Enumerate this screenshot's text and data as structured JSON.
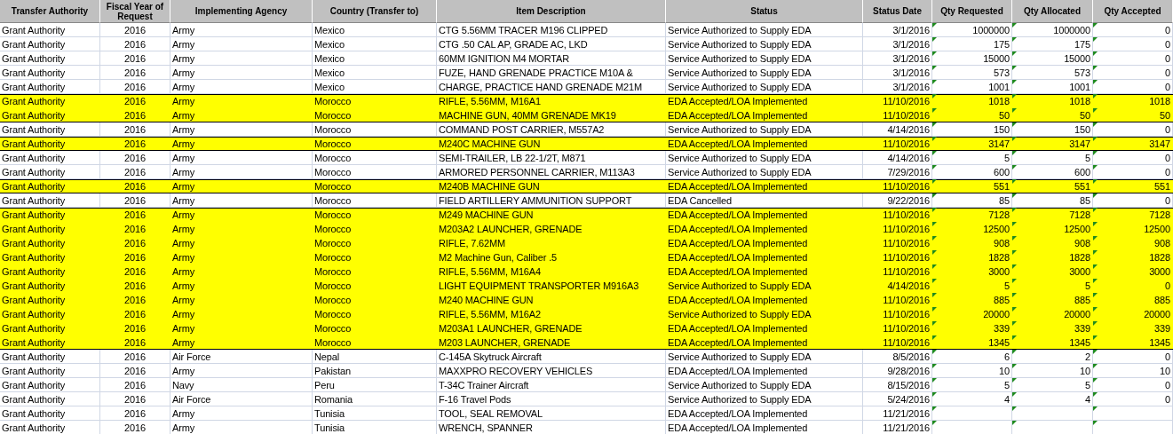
{
  "table": {
    "columns": [
      "Transfer Authority",
      "Fiscal Year of Request",
      "Implementing Agency",
      "Country (Transfer to)",
      "Item Description",
      "Status",
      "Status Date",
      "Qty Requested",
      "Qty Allocated",
      "Qty Accepted"
    ],
    "rows": [
      {
        "highlighted": false,
        "cells": [
          "Grant Authority",
          "2016",
          "Army",
          "Mexico",
          "CTG 5.56MM TRACER M196 CLIPPED",
          "Service Authorized to Supply EDA",
          "3/1/2016",
          "1000000",
          "1000000",
          "0"
        ]
      },
      {
        "highlighted": false,
        "cells": [
          "Grant Authority",
          "2016",
          "Army",
          "Mexico",
          "CTG .50 CAL AP, GRADE AC, LKD",
          "Service Authorized to Supply EDA",
          "3/1/2016",
          "175",
          "175",
          "0"
        ]
      },
      {
        "highlighted": false,
        "cells": [
          "Grant Authority",
          "2016",
          "Army",
          "Mexico",
          "60MM IGNITION M4 MORTAR",
          "Service Authorized to Supply EDA",
          "3/1/2016",
          "15000",
          "15000",
          "0"
        ]
      },
      {
        "highlighted": false,
        "cells": [
          "Grant Authority",
          "2016",
          "Army",
          "Mexico",
          "FUZE, HAND GRENADE PRACTICE M10A &",
          "Service Authorized to Supply EDA",
          "3/1/2016",
          "573",
          "573",
          "0"
        ]
      },
      {
        "highlighted": false,
        "cells": [
          "Grant Authority",
          "2016",
          "Army",
          "Mexico",
          "CHARGE, PRACTICE HAND GRENADE M21M",
          "Service Authorized to Supply EDA",
          "3/1/2016",
          "1001",
          "1001",
          "0"
        ]
      },
      {
        "highlighted": true,
        "cells": [
          "Grant Authority",
          "2016",
          "Army",
          "Morocco",
          "RIFLE, 5.56MM, M16A1",
          "EDA Accepted/LOA Implemented",
          "11/10/2016",
          "1018",
          "1018",
          "1018"
        ]
      },
      {
        "highlighted": true,
        "cells": [
          "Grant Authority",
          "2016",
          "Army",
          "Morocco",
          "MACHINE GUN, 40MM GRENADE MK19",
          "EDA Accepted/LOA Implemented",
          "11/10/2016",
          "50",
          "50",
          "50"
        ]
      },
      {
        "highlighted": false,
        "cells": [
          "Grant Authority",
          "2016",
          "Army",
          "Morocco",
          "COMMAND POST CARRIER, M557A2",
          "Service Authorized to Supply EDA",
          "4/14/2016",
          "150",
          "150",
          "0"
        ]
      },
      {
        "highlighted": true,
        "cells": [
          "Grant Authority",
          "2016",
          "Army",
          "Morocco",
          "M240C MACHINE GUN",
          "EDA Accepted/LOA Implemented",
          "11/10/2016",
          "3147",
          "3147",
          "3147"
        ]
      },
      {
        "highlighted": false,
        "cells": [
          "Grant Authority",
          "2016",
          "Army",
          "Morocco",
          "SEMI-TRAILER, LB 22-1/2T, M871",
          "Service Authorized to Supply EDA",
          "4/14/2016",
          "5",
          "5",
          "0"
        ]
      },
      {
        "highlighted": false,
        "cells": [
          "Grant Authority",
          "2016",
          "Army",
          "Morocco",
          "ARMORED PERSONNEL CARRIER, M113A3",
          "Service Authorized to Supply EDA",
          "7/29/2016",
          "600",
          "600",
          "0"
        ]
      },
      {
        "highlighted": true,
        "cells": [
          "Grant Authority",
          "2016",
          "Army",
          "Morocco",
          "M240B MACHINE GUN",
          "EDA Accepted/LOA Implemented",
          "11/10/2016",
          "551",
          "551",
          "551"
        ]
      },
      {
        "highlighted": false,
        "cells": [
          "Grant Authority",
          "2016",
          "Army",
          "Morocco",
          "FIELD ARTILLERY AMMUNITION SUPPORT",
          "EDA Cancelled",
          "9/22/2016",
          "85",
          "85",
          "0"
        ]
      },
      {
        "highlighted": true,
        "cells": [
          "Grant Authority",
          "2016",
          "Army",
          "Morocco",
          "M249 MACHINE GUN",
          "EDA Accepted/LOA Implemented",
          "11/10/2016",
          "7128",
          "7128",
          "7128"
        ]
      },
      {
        "highlighted": true,
        "cells": [
          "Grant Authority",
          "2016",
          "Army",
          "Morocco",
          "M203A2 LAUNCHER, GRENADE",
          "EDA Accepted/LOA Implemented",
          "11/10/2016",
          "12500",
          "12500",
          "12500"
        ]
      },
      {
        "highlighted": true,
        "cells": [
          "Grant Authority",
          "2016",
          "Army",
          "Morocco",
          "RIFLE, 7.62MM",
          "EDA Accepted/LOA Implemented",
          "11/10/2016",
          "908",
          "908",
          "908"
        ]
      },
      {
        "highlighted": true,
        "cells": [
          "Grant Authority",
          "2016",
          "Army",
          "Morocco",
          "M2 Machine Gun, Caliber .5",
          "EDA Accepted/LOA Implemented",
          "11/10/2016",
          "1828",
          "1828",
          "1828"
        ]
      },
      {
        "highlighted": true,
        "cells": [
          "Grant Authority",
          "2016",
          "Army",
          "Morocco",
          "RIFLE, 5.56MM, M16A4",
          "EDA Accepted/LOA Implemented",
          "11/10/2016",
          "3000",
          "3000",
          "3000"
        ]
      },
      {
        "highlighted": true,
        "cells": [
          "Grant Authority",
          "2016",
          "Army",
          "Morocco",
          "LIGHT EQUIPMENT TRANSPORTER M916A3",
          "Service Authorized to Supply EDA",
          "4/14/2016",
          "5",
          "5",
          "0"
        ]
      },
      {
        "highlighted": true,
        "cells": [
          "Grant Authority",
          "2016",
          "Army",
          "Morocco",
          "M240 MACHINE GUN",
          "EDA Accepted/LOA Implemented",
          "11/10/2016",
          "885",
          "885",
          "885"
        ]
      },
      {
        "highlighted": true,
        "cells": [
          "Grant Authority",
          "2016",
          "Army",
          "Morocco",
          "RIFLE, 5.56MM, M16A2",
          "Service Authorized to Supply EDA",
          "11/10/2016",
          "20000",
          "20000",
          "20000"
        ]
      },
      {
        "highlighted": true,
        "cells": [
          "Grant Authority",
          "2016",
          "Army",
          "Morocco",
          "M203A1 LAUNCHER, GRENADE",
          "EDA Accepted/LOA Implemented",
          "11/10/2016",
          "339",
          "339",
          "339"
        ]
      },
      {
        "highlighted": true,
        "cells": [
          "Grant Authority",
          "2016",
          "Army",
          "Morocco",
          "M203 LAUNCHER, GRENADE",
          "EDA Accepted/LOA Implemented",
          "11/10/2016",
          "1345",
          "1345",
          "1345"
        ]
      },
      {
        "highlighted": false,
        "cells": [
          "Grant Authority",
          "2016",
          "Air Force",
          "Nepal",
          "C-145A Skytruck Aircraft",
          "Service Authorized to Supply EDA",
          "8/5/2016",
          "6",
          "2",
          "0"
        ]
      },
      {
        "highlighted": false,
        "cells": [
          "Grant Authority",
          "2016",
          "Army",
          "Pakistan",
          "MAXXPRO RECOVERY VEHICLES",
          "EDA Accepted/LOA Implemented",
          "9/28/2016",
          "10",
          "10",
          "10"
        ]
      },
      {
        "highlighted": false,
        "cells": [
          "Grant Authority",
          "2016",
          "Navy",
          "Peru",
          "T-34C Trainer Aircraft",
          "Service Authorized to Supply EDA",
          "8/15/2016",
          "5",
          "5",
          "0"
        ]
      },
      {
        "highlighted": false,
        "cells": [
          "Grant Authority",
          "2016",
          "Air Force",
          "Romania",
          "F-16 Travel Pods",
          "Service Authorized to Supply EDA",
          "5/24/2016",
          "4",
          "4",
          "0"
        ]
      },
      {
        "highlighted": false,
        "cells": [
          "Grant Authority",
          "2016",
          "Army",
          "Tunisia",
          "TOOL, SEAL REMOVAL",
          "EDA Accepted/LOA Implemented",
          "11/21/2016"
        ]
      },
      {
        "highlighted": false,
        "cells": [
          "Grant Authority",
          "2016",
          "Army",
          "Tunisia",
          "WRENCH, SPANNER",
          "EDA Accepted/LOA Implemented",
          "11/21/2016"
        ]
      }
    ]
  }
}
